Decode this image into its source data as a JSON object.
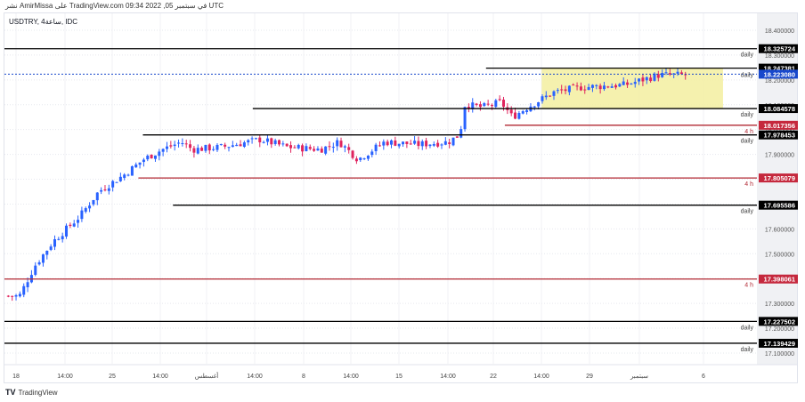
{
  "caption": "نشر AmirMissa على TradingView.com 09:34 2022 ,05 في سبتمبر UTC",
  "symbol_line": "USDTRY, 4ساعة, IDC",
  "footer_brand": "TradingView",
  "colors": {
    "up": "#2962ff",
    "down": "#e0245e",
    "level_black": "#000000",
    "level_red": "#b22833",
    "current": "#1848cc",
    "zone": "#f3eea0"
  },
  "chart_data": {
    "type": "candlestick",
    "symbol": "USDTRY",
    "timeframe": "4h",
    "ylim": [
      17.06,
      18.46
    ],
    "y_ticks": [
      "18.400000",
      "18.300000",
      "18.200000",
      "18.100000",
      "18.000000",
      "17.900000",
      "17.800000",
      "17.700000",
      "17.600000",
      "17.500000",
      "17.400000",
      "17.300000",
      "17.200000",
      "17.100000"
    ],
    "x_ticks": [
      "18",
      "14:00",
      "25",
      "14:00",
      "أغسطس",
      "14:00",
      "8",
      "14:00",
      "15",
      "14:00",
      "22",
      "14:00",
      "29",
      "سبتمبر",
      "6"
    ],
    "current_price": {
      "value": "18.223080",
      "label": "daily"
    },
    "levels": [
      {
        "value": "18.325724",
        "tf": "daily",
        "color": "black",
        "start": 0.0
      },
      {
        "value": "18.247381",
        "tf": "",
        "color": "black",
        "start": 0.64
      },
      {
        "value": "18.084578",
        "tf": "daily",
        "color": "black",
        "start": 0.33
      },
      {
        "value": "18.017356",
        "tf": "4 h",
        "color": "red",
        "start": 0.665
      },
      {
        "value": "17.978453",
        "tf": "daily",
        "color": "black",
        "start": 0.184
      },
      {
        "value": "17.805079",
        "tf": "4 h",
        "color": "red",
        "start": 0.178
      },
      {
        "value": "17.695586",
        "tf": "daily",
        "color": "black",
        "start": 0.224
      },
      {
        "value": "17.398061",
        "tf": "4 h",
        "color": "red",
        "start": 0.0
      },
      {
        "value": "17.227502",
        "tf": "daily",
        "color": "black",
        "start": 0.0
      },
      {
        "value": "17.139429",
        "tf": "daily",
        "color": "black",
        "start": 0.0
      }
    ],
    "range_zone": {
      "top": 18.247381,
      "bottom": 18.084578,
      "from": 0.714,
      "to": 0.955
    },
    "price_path": [
      [
        0,
        17.33
      ],
      [
        0.02,
        17.33
      ],
      [
        0.04,
        17.45
      ],
      [
        0.065,
        17.55
      ],
      [
        0.1,
        17.65
      ],
      [
        0.125,
        17.75
      ],
      [
        0.16,
        17.82
      ],
      [
        0.185,
        17.88
      ],
      [
        0.21,
        17.92
      ],
      [
        0.235,
        17.95
      ],
      [
        0.25,
        17.92
      ],
      [
        0.29,
        17.93
      ],
      [
        0.34,
        17.96
      ],
      [
        0.375,
        17.93
      ],
      [
        0.42,
        17.92
      ],
      [
        0.445,
        17.95
      ],
      [
        0.47,
        17.88
      ],
      [
        0.505,
        17.95
      ],
      [
        0.55,
        17.94
      ],
      [
        0.59,
        17.95
      ],
      [
        0.605,
        17.98
      ],
      [
        0.612,
        18.1
      ],
      [
        0.635,
        18.09
      ],
      [
        0.66,
        18.11
      ],
      [
        0.675,
        18.05
      ],
      [
        0.695,
        18.09
      ],
      [
        0.73,
        18.15
      ],
      [
        0.765,
        18.17
      ],
      [
        0.825,
        18.18
      ],
      [
        0.87,
        18.22
      ],
      [
        0.905,
        18.22
      ]
    ]
  }
}
